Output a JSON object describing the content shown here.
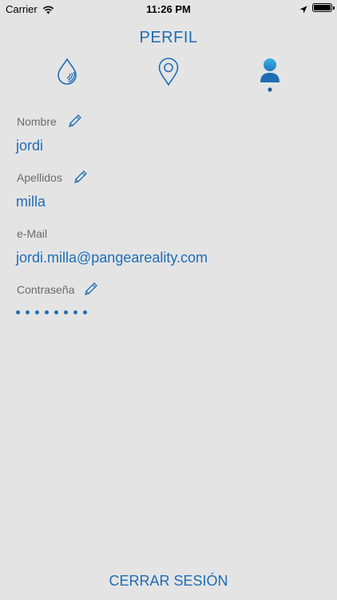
{
  "status_bar": {
    "carrier": "Carrier",
    "time": "11:26 PM",
    "icons": [
      "wifi-icon",
      "location-arrow-icon",
      "battery-icon"
    ]
  },
  "header": {
    "title": "PERFIL"
  },
  "tabs": [
    {
      "icon": "water-drop-icon",
      "active": false
    },
    {
      "icon": "map-pin-icon",
      "active": false
    },
    {
      "icon": "user-icon",
      "active": true
    }
  ],
  "profile": {
    "nombre_label": "Nombre",
    "nombre_value": "jordi",
    "apellidos_label": "Apellidos",
    "apellidos_value": "milla",
    "email_label": "e-Mail",
    "email_value": "jordi.milla@pangeareality.com",
    "password_label": "Contraseña",
    "password_length": 8
  },
  "footer": {
    "logout_label": "CERRAR SESIÓN"
  },
  "colors": {
    "accent": "#1e6db4",
    "accent_light": "#2a9ad8",
    "background": "#e4e4e5",
    "label": "#6b6b6b"
  }
}
